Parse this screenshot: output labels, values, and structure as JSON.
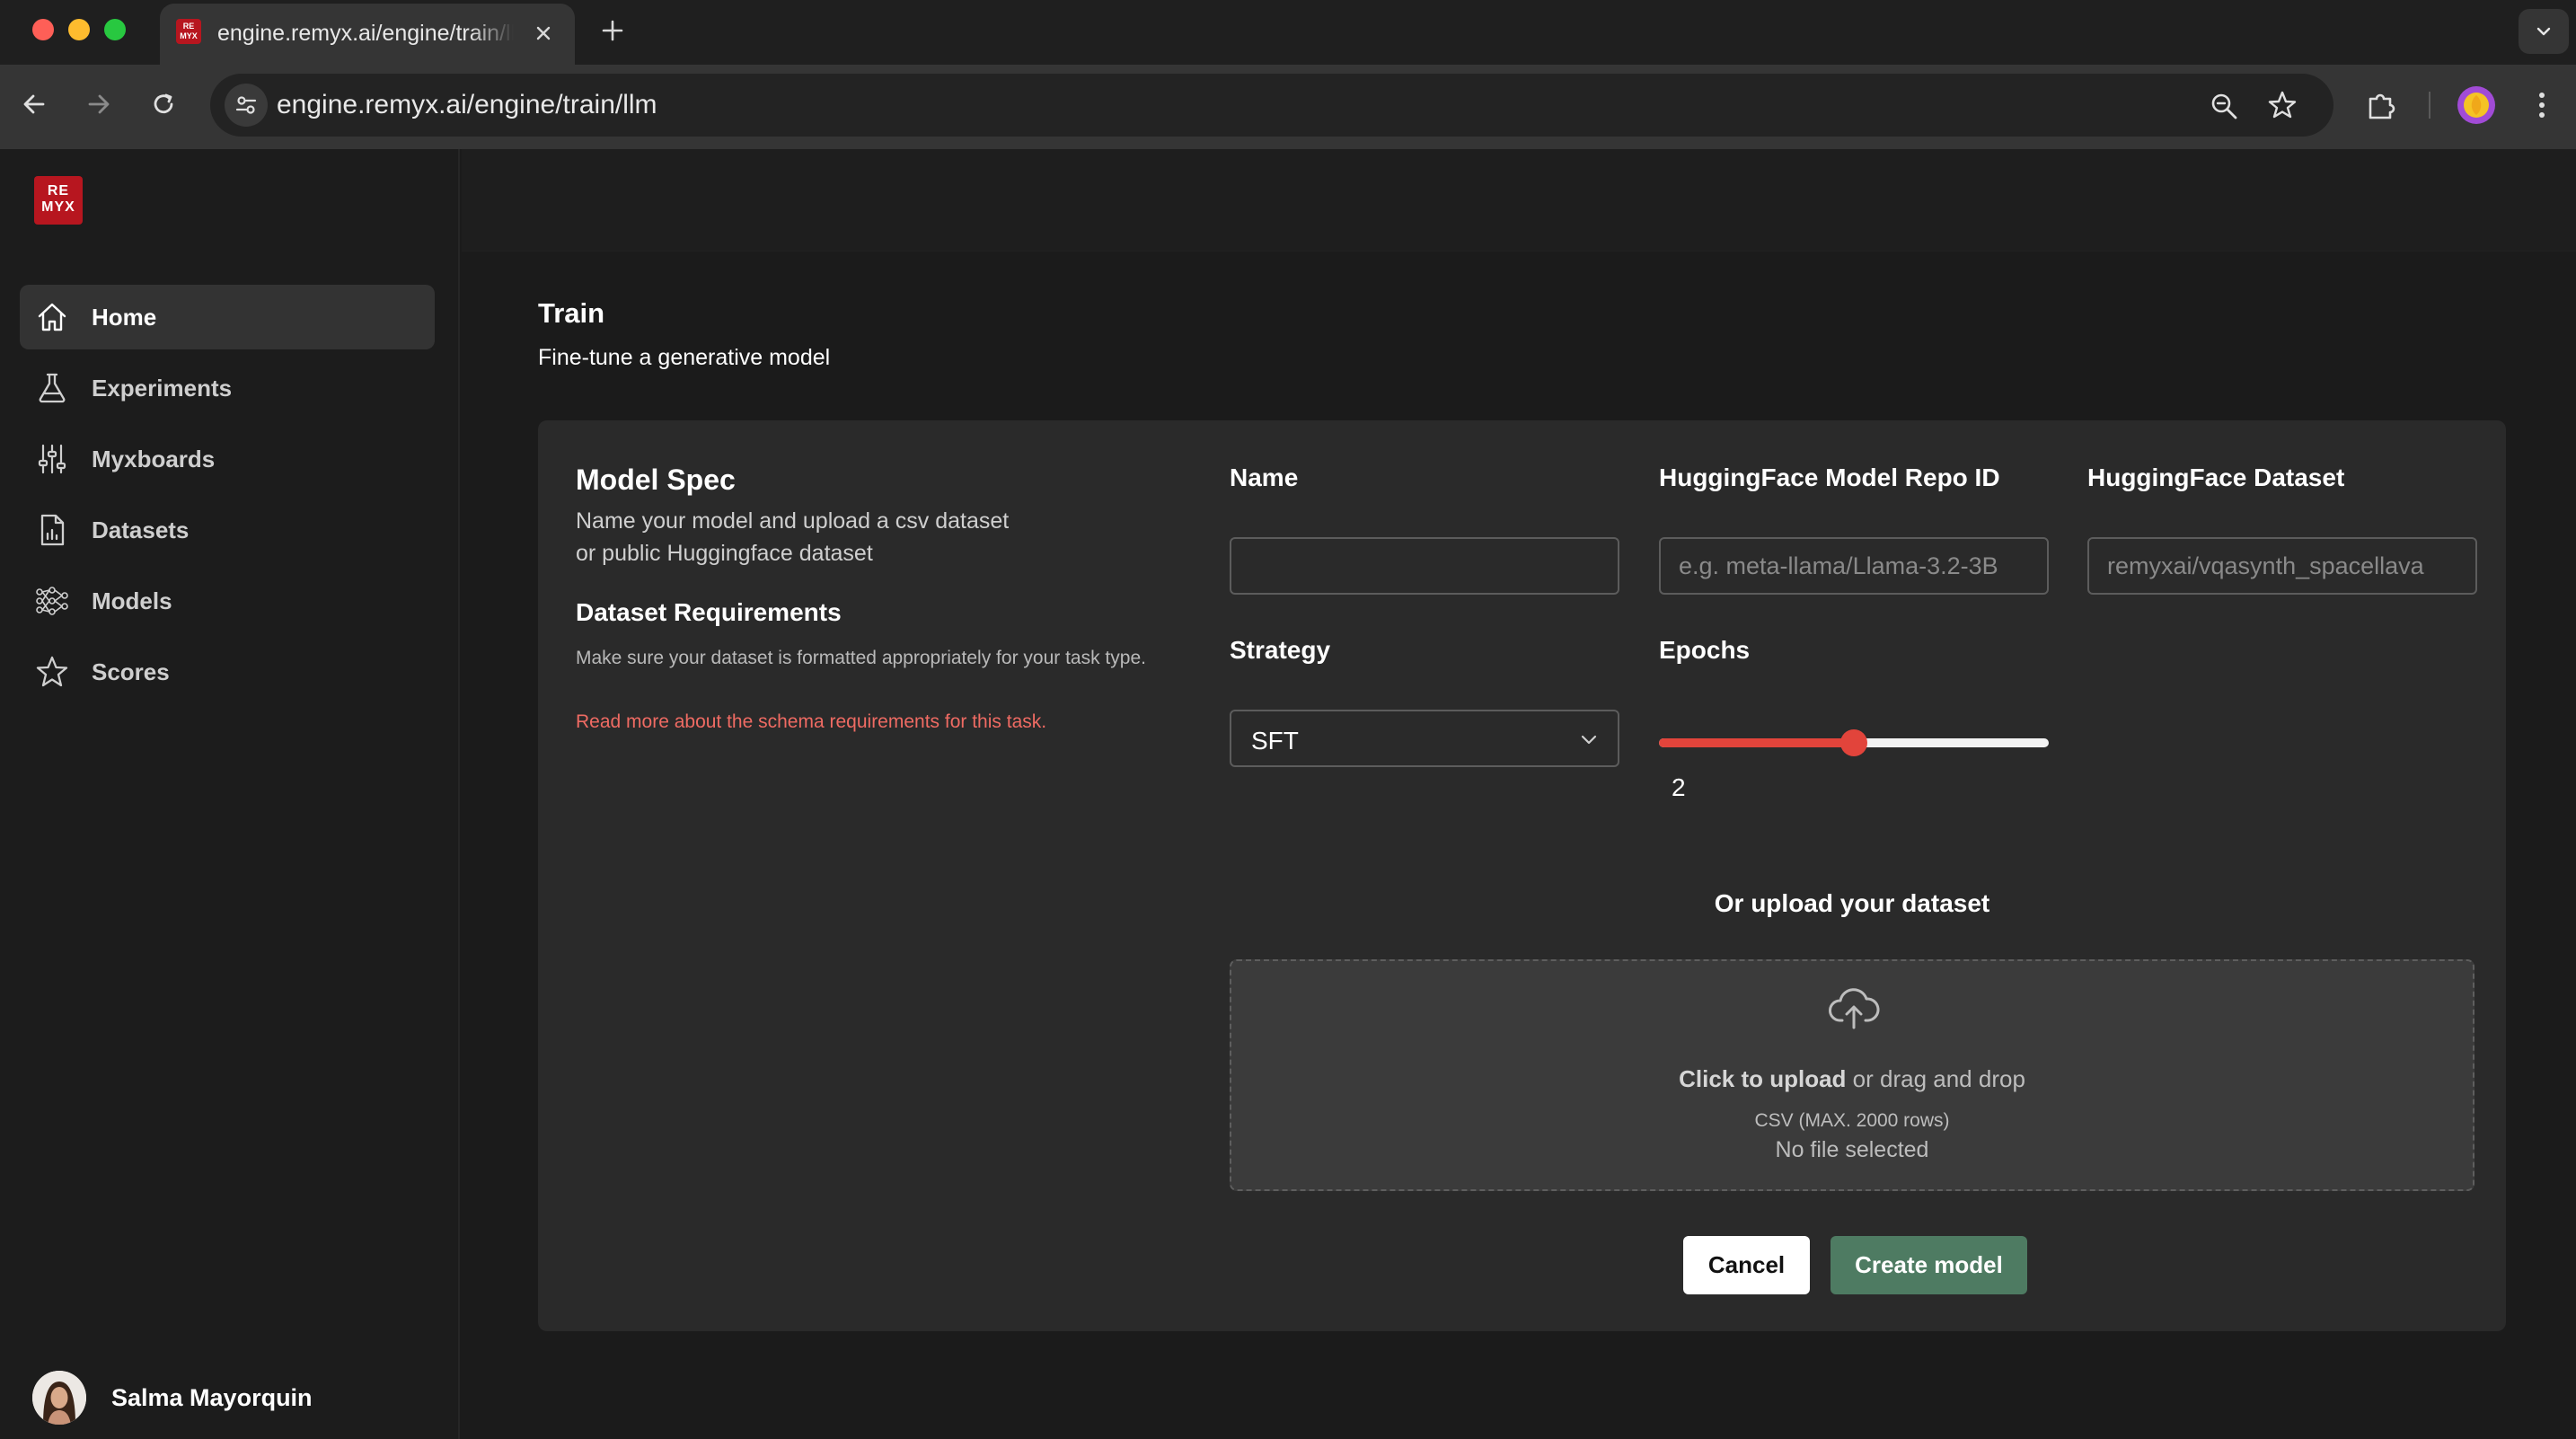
{
  "browser": {
    "tab_title": "engine.remyx.ai/engine/train/llm",
    "url": "engine.remyx.ai/engine/train/llm",
    "favicon_text": "RE MYX"
  },
  "sidebar": {
    "logo_text": "RE MYX",
    "items": [
      {
        "label": "Home",
        "icon": "home-icon",
        "active": true
      },
      {
        "label": "Experiments",
        "icon": "flask-icon",
        "active": false
      },
      {
        "label": "Myxboards",
        "icon": "sliders-icon",
        "active": false
      },
      {
        "label": "Datasets",
        "icon": "document-chart-icon",
        "active": false
      },
      {
        "label": "Models",
        "icon": "network-icon",
        "active": false
      },
      {
        "label": "Scores",
        "icon": "star-icon",
        "active": false
      }
    ],
    "user": {
      "name": "Salma Mayorquin"
    }
  },
  "page": {
    "title": "Train",
    "subtitle": "Fine-tune a generative model"
  },
  "form": {
    "spec_title": "Model Spec",
    "spec_desc_line1": "Name your model and upload a csv dataset",
    "spec_desc_line2": "or public Huggingface dataset",
    "req_title": "Dataset Requirements",
    "req_desc": "Make sure your dataset is formatted appropriately for your task type.",
    "req_link": "Read more about the schema requirements for this task.",
    "name_label": "Name",
    "name_value": "",
    "repo_label": "HuggingFace Model Repo ID",
    "repo_placeholder": "e.g. meta-llama/Llama-3.2-3B",
    "dataset_label": "HuggingFace Dataset",
    "dataset_placeholder": "remyxai/vqasynth_spacellava",
    "strategy_label": "Strategy",
    "strategy_value": "SFT",
    "epochs_label": "Epochs",
    "epochs_value": "2",
    "epochs_fill_fraction": 0.5,
    "upload_heading": "Or upload your dataset",
    "upload_action": "Click to upload",
    "upload_rest": " or drag and drop",
    "upload_hint": "CSV (MAX. 2000 rows)",
    "upload_status": "No file selected",
    "cancel_label": "Cancel",
    "create_label": "Create model"
  },
  "colors": {
    "accent_red": "#e2443b",
    "link_red": "#ef6b63",
    "create_green": "#4e7b62",
    "brand_red": "#b7161f"
  }
}
